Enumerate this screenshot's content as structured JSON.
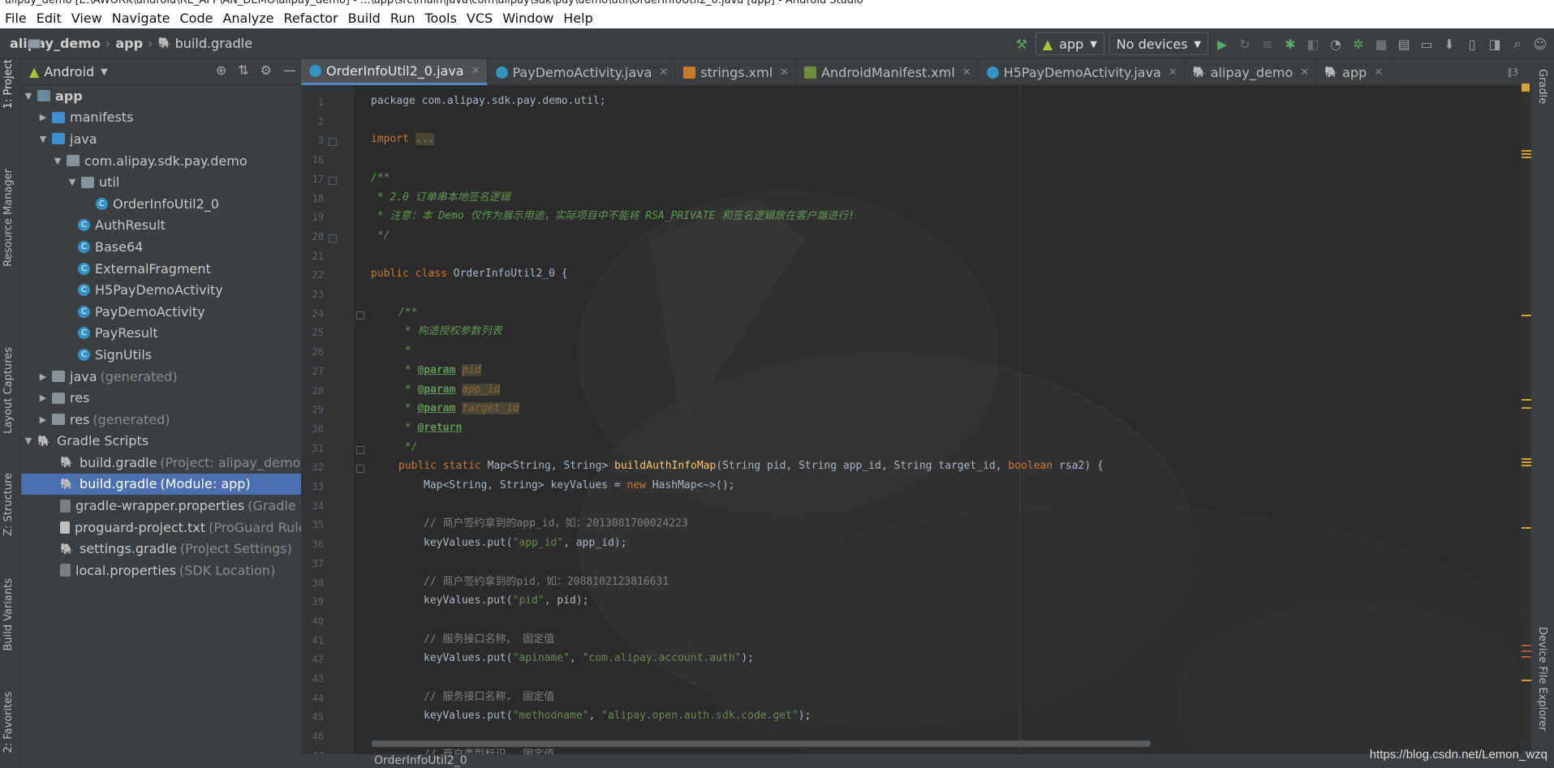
{
  "window": {
    "title": "alipay_demo [E:\\AWORK\\android\\RE_APP\\AN_DEMO\\alipay_demo] - ...\\app\\src\\main\\java\\com\\alipay\\sdk\\pay\\demo\\util\\OrderInfoUtil2_0.java [app] - Android Studio"
  },
  "menu": [
    "File",
    "Edit",
    "View",
    "Navigate",
    "Code",
    "Analyze",
    "Refactor",
    "Build",
    "Run",
    "Tools",
    "VCS",
    "Window",
    "Help"
  ],
  "breadcrumb": {
    "project": "alipay_demo",
    "module": "app",
    "file": "build.gradle"
  },
  "toolbar": {
    "config": "app",
    "devices": "No devices"
  },
  "left_tool_windows": [
    "1: Project",
    "Resource Manager",
    "Layout Captures",
    "Z: Structure",
    "Build Variants",
    "2: Favorites"
  ],
  "right_tool_windows": [
    "Gradle",
    "Device File Explorer"
  ],
  "project_panel": {
    "view": "Android",
    "tree": [
      {
        "label": "app",
        "extra": ""
      },
      {
        "label": "manifests",
        "extra": ""
      },
      {
        "label": "java",
        "extra": ""
      },
      {
        "label": "com.alipay.sdk.pay.demo",
        "extra": ""
      },
      {
        "label": "util",
        "extra": ""
      },
      {
        "label": "OrderInfoUtil2_0",
        "extra": ""
      },
      {
        "label": "AuthResult",
        "extra": ""
      },
      {
        "label": "Base64",
        "extra": ""
      },
      {
        "label": "ExternalFragment",
        "extra": ""
      },
      {
        "label": "H5PayDemoActivity",
        "extra": ""
      },
      {
        "label": "PayDemoActivity",
        "extra": ""
      },
      {
        "label": "PayResult",
        "extra": ""
      },
      {
        "label": "SignUtils",
        "extra": ""
      },
      {
        "label": "java",
        "extra": "(generated)"
      },
      {
        "label": "res",
        "extra": ""
      },
      {
        "label": "res",
        "extra": "(generated)"
      },
      {
        "label": "Gradle Scripts",
        "extra": ""
      },
      {
        "label": "build.gradle",
        "extra": "(Project: alipay_demo)"
      },
      {
        "label": "build.gradle",
        "extra": "(Module: app)"
      },
      {
        "label": "gradle-wrapper.properties",
        "extra": "(Gradle Ve"
      },
      {
        "label": "proguard-project.txt",
        "extra": "(ProGuard Rules"
      },
      {
        "label": "settings.gradle",
        "extra": "(Project Settings)"
      },
      {
        "label": "local.properties",
        "extra": "(SDK Location)"
      }
    ]
  },
  "tabs": [
    "OrderInfoUtil2_0.java",
    "PayDemoActivity.java",
    "strings.xml",
    "AndroidManifest.xml",
    "H5PayDemoActivity.java",
    "alipay_demo",
    "app"
  ],
  "tab_overflow": "∥3",
  "line_numbers": [
    "1",
    "2",
    "3",
    "16",
    "17",
    "18",
    "19",
    "20",
    "21",
    "22",
    "23",
    "24",
    "25",
    "26",
    "27",
    "28",
    "29",
    "30",
    "31",
    "32",
    "33",
    "34",
    "35",
    "36",
    "37",
    "38",
    "39",
    "40",
    "41",
    "42",
    "43",
    "44",
    "45",
    "46",
    "47"
  ],
  "code": {
    "l1": "package com.alipay.sdk.pay.demo.util;",
    "l3_import": "import",
    "l3_dots": "...",
    "l17": "/**",
    "l18": " * 2.0 订单串本地签名逻辑",
    "l19_a": " * 注意：本 ",
    "l19_b": "Demo",
    "l19_c": " 仅作为展示用途，实际项目中不能将 ",
    "l19_d": "RSA_PRIVATE",
    "l19_e": " 和签名逻辑放在客户端进行!",
    "l20": " */",
    "l22_kw": "public class",
    "l22_rest": " OrderInfoUtil2_0 {",
    "l24": "/**",
    "l25": " * 构造授权参数列表",
    "l26": " *",
    "l27_tag": "@param",
    "l27_p": "pid",
    "l28_p": "app_id",
    "l29_p": "target_id",
    "l30_tag": "@return",
    "l31": " */",
    "l32_kw": "public static",
    "l32_a": " Map<String, String> ",
    "l32_fn": "buildAuthInfoMap",
    "l32_b": "(String pid, String app_id, String target_id, ",
    "l32_kw2": "boolean",
    "l32_c": " rsa2) {",
    "l33_a": "Map<String, String> keyValues = ",
    "l33_kw": "new",
    "l33_b": " HashMap<~>();",
    "l35": "// 商户签约拿到的app_id，如：2013081700024223",
    "l36_a": "keyValues.put(",
    "l36_s": "\"app_id\"",
    "l36_b": ", app_id);",
    "l38": "// 商户签约拿到的pid，如：2088102123816631",
    "l39_s": "\"pid\"",
    "l39_b": ", pid);",
    "l41": "// 服务接口名称， 固定值",
    "l42_s": "\"apiname\"",
    "l42_s2": "\"com.alipay.account.auth\"",
    "l42_b": ");",
    "l44": "// 服务接口名称， 固定值",
    "l45_s": "\"methodname\"",
    "l45_s2": "\"alipay.open.auth.sdk.code.get\"",
    "l47": "// 商户类型标识， 固定值"
  },
  "status": {
    "breadcrumb": "OrderInfoUtil2_0"
  },
  "watermark": "https://blog.csdn.net/Lemon_wzq"
}
